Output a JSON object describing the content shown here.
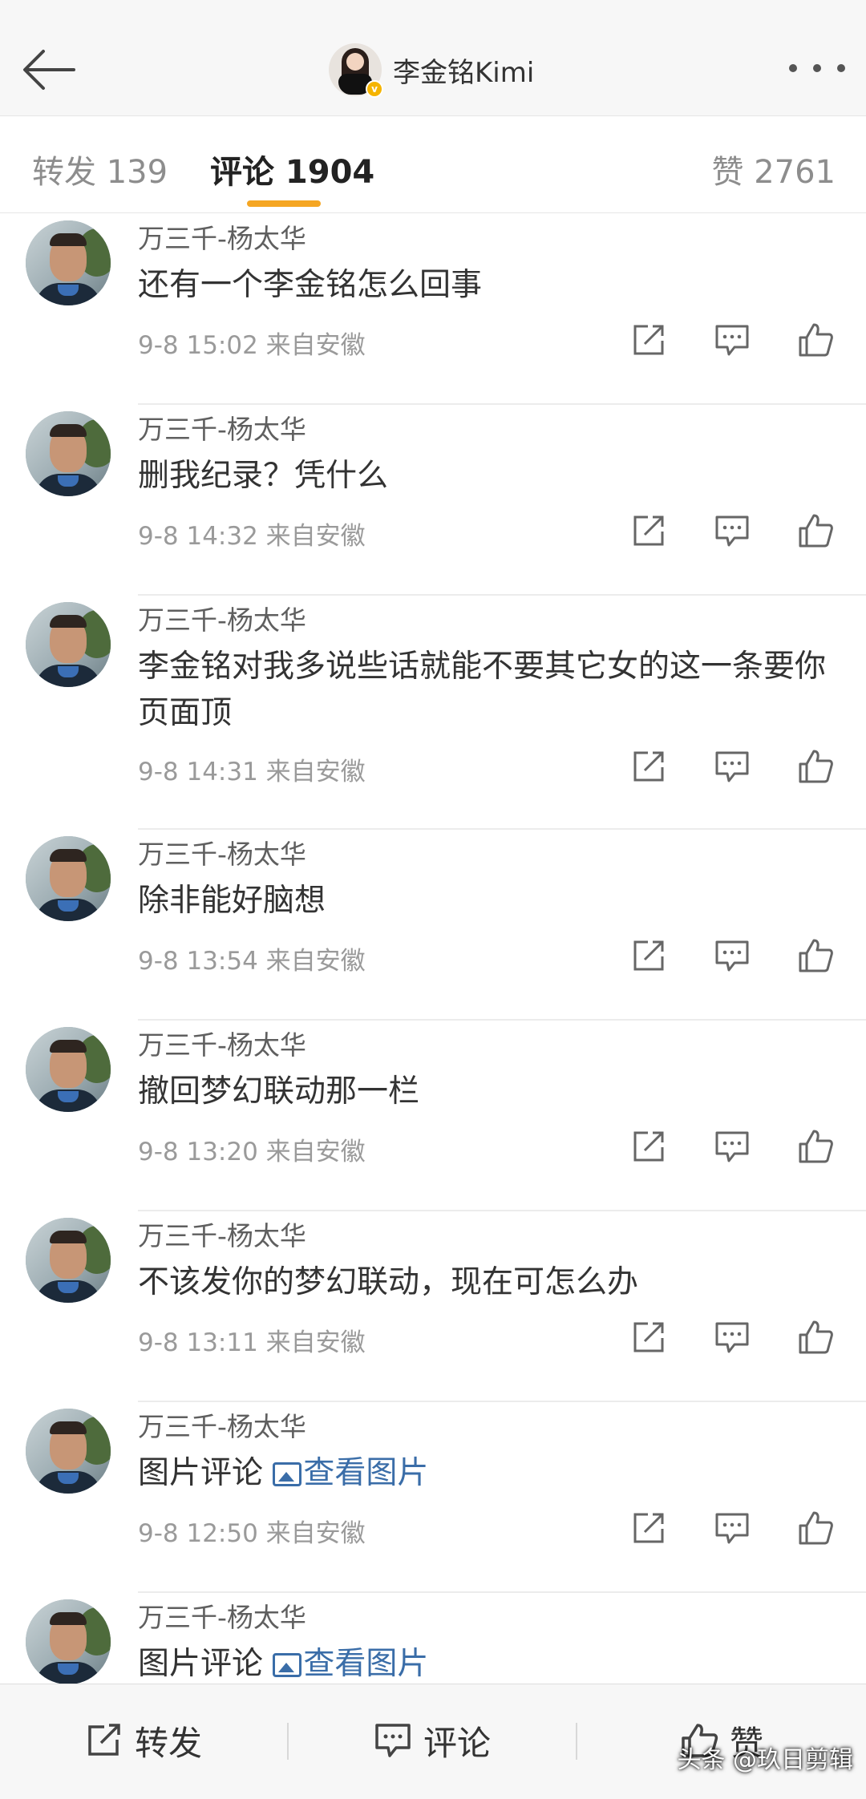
{
  "header": {
    "back_icon": "back-arrow-icon",
    "title": "李金铭Kimi",
    "more_icon": "more-dots-icon"
  },
  "tabs": [
    {
      "label": "转发 139"
    },
    {
      "label": "评论 1904"
    },
    {
      "label": "赞 2761"
    }
  ],
  "comments": [
    {
      "user": "万三千-杨太华",
      "text": "还有一个李金铭怎么回事",
      "meta": "9-8 15:02  来自安徽"
    },
    {
      "user": "万三千-杨太华",
      "text": "删我纪录？凭什么",
      "meta": "9-8 14:32  来自安徽"
    },
    {
      "user": "万三千-杨太华",
      "text": "李金铭对我多说些话就能不要其它女的这一条要你页面顶",
      "meta": "9-8 14:31  来自安徽"
    },
    {
      "user": "万三千-杨太华",
      "text": "除非能好脑想",
      "meta": "9-8 13:54  来自安徽"
    },
    {
      "user": "万三千-杨太华",
      "text": "撤回梦幻联动那一栏",
      "meta": "9-8 13:20  来自安徽"
    },
    {
      "user": "万三千-杨太华",
      "text": "不该发你的梦幻联动，现在可怎么办",
      "meta": "9-8 13:11  来自安徽"
    },
    {
      "user": "万三千-杨太华",
      "text": "图片评论",
      "link": "查看图片",
      "meta": "9-8 12:50  来自安徽"
    },
    {
      "user": "万三千-杨太华",
      "text": "图片评论",
      "link": "查看图片",
      "meta": ""
    }
  ],
  "item_icons": [
    "repost-icon",
    "comment-icon",
    "like-icon"
  ],
  "bottom_bar": {
    "repost_label": "转发",
    "comment_label": "评论",
    "like_label": "赞"
  },
  "watermark": "头条 @玖日剪辑",
  "colors": {
    "accent": "#f5a623",
    "link": "#3a6da8",
    "meta": "#9a9a9a"
  }
}
